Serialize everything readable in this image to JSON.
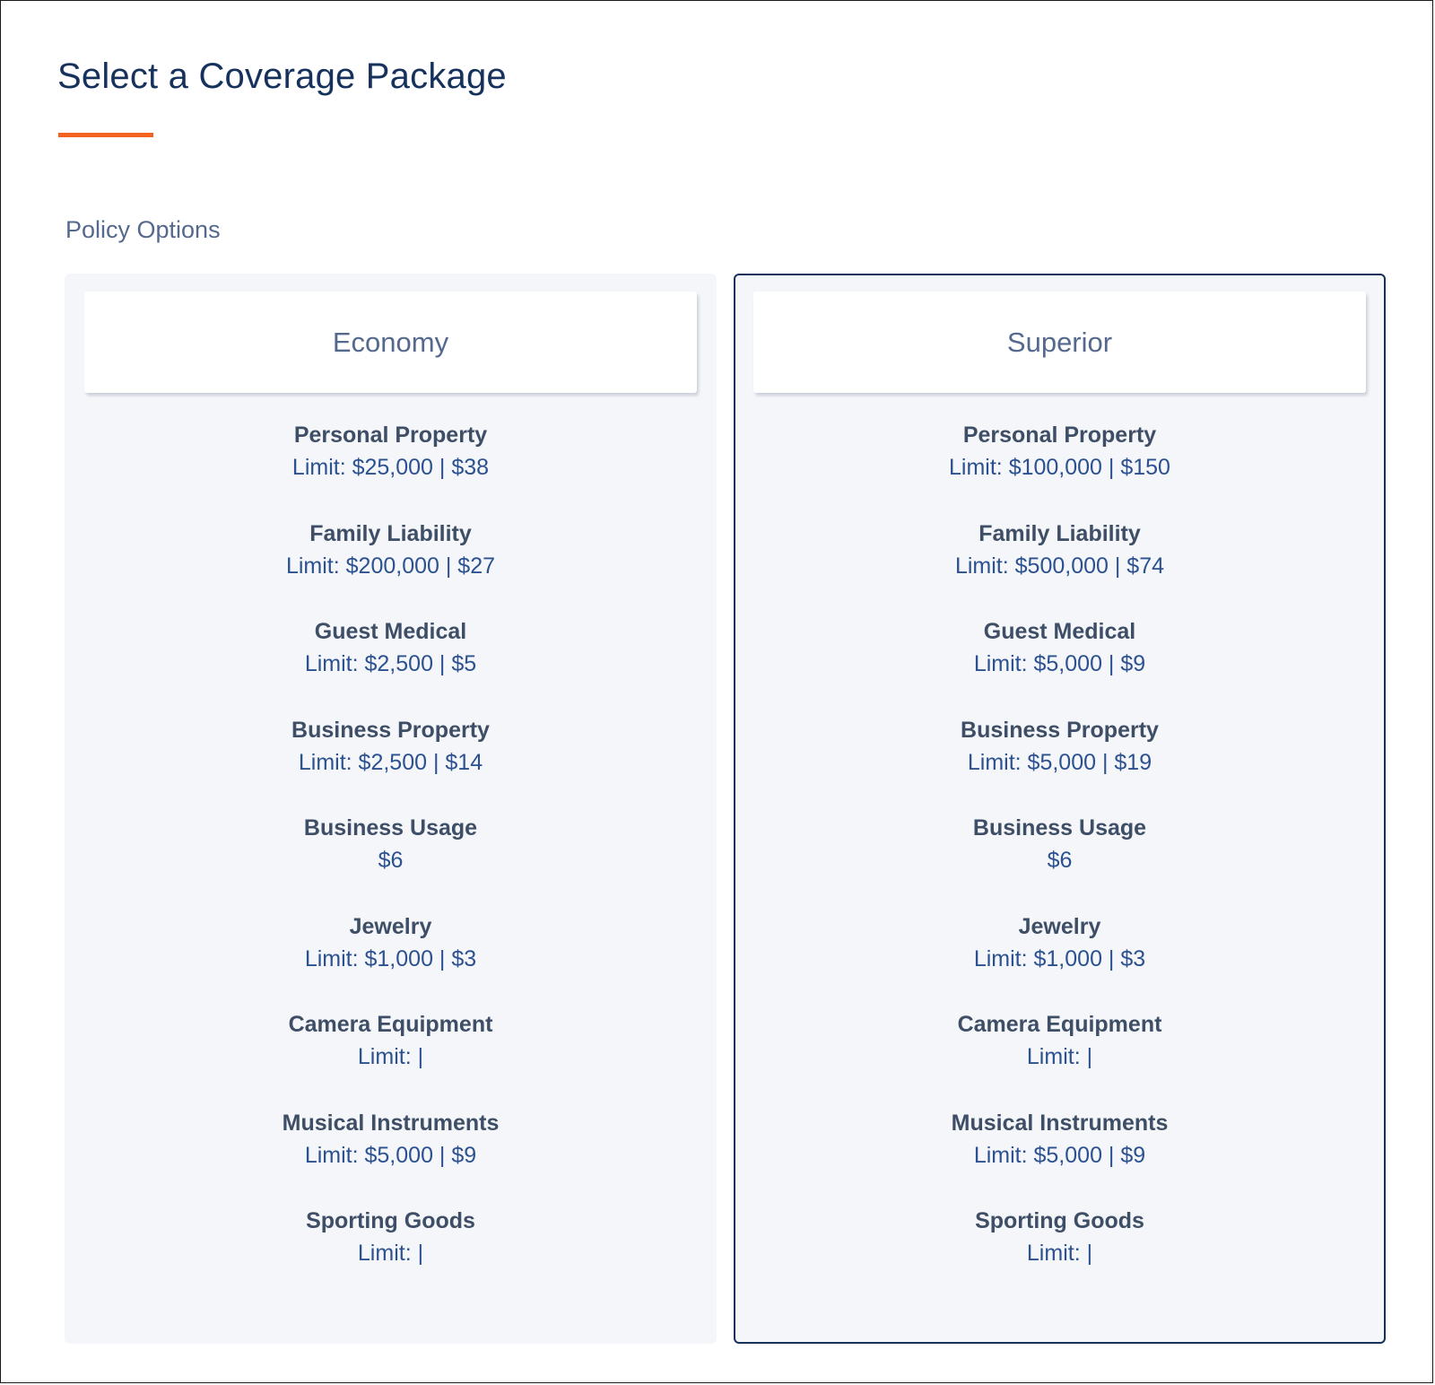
{
  "page": {
    "title": "Select a Coverage Package",
    "section_label": "Policy Options",
    "accent_color": "#f4621f",
    "selected_border_color": "#16325c"
  },
  "packages": [
    {
      "name": "Economy",
      "selected": false,
      "coverages": [
        {
          "name": "Personal Property",
          "detail": "Limit: $25,000 | $38"
        },
        {
          "name": "Family Liability",
          "detail": "Limit: $200,000 | $27"
        },
        {
          "name": "Guest Medical",
          "detail": "Limit: $2,500 | $5"
        },
        {
          "name": "Business Property",
          "detail": "Limit: $2,500 | $14"
        },
        {
          "name": "Business Usage",
          "detail": "$6"
        },
        {
          "name": "Jewelry",
          "detail": "Limit: $1,000 | $3"
        },
        {
          "name": "Camera Equipment",
          "detail": "Limit: |"
        },
        {
          "name": "Musical Instruments",
          "detail": "Limit: $5,000 | $9"
        },
        {
          "name": "Sporting Goods",
          "detail": "Limit: |"
        }
      ]
    },
    {
      "name": "Superior",
      "selected": true,
      "coverages": [
        {
          "name": "Personal Property",
          "detail": "Limit: $100,000 | $150"
        },
        {
          "name": "Family Liability",
          "detail": "Limit: $500,000 | $74"
        },
        {
          "name": "Guest Medical",
          "detail": "Limit: $5,000 | $9"
        },
        {
          "name": "Business Property",
          "detail": "Limit: $5,000 | $19"
        },
        {
          "name": "Business Usage",
          "detail": "$6"
        },
        {
          "name": "Jewelry",
          "detail": "Limit: $1,000 | $3"
        },
        {
          "name": "Camera Equipment",
          "detail": "Limit: |"
        },
        {
          "name": "Musical Instruments",
          "detail": "Limit: $5,000 | $9"
        },
        {
          "name": "Sporting Goods",
          "detail": "Limit: |"
        }
      ]
    }
  ]
}
